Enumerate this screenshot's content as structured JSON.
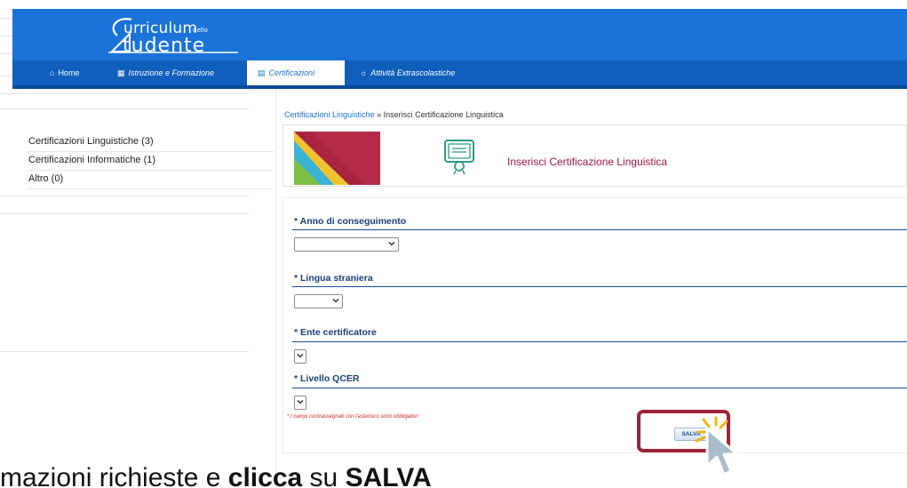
{
  "header": {
    "logo_top": "urriculum",
    "logo_small": "dello",
    "logo_bottom": "tudente"
  },
  "nav": [
    {
      "label": "Home",
      "icon": "home-icon",
      "active": false
    },
    {
      "label": "Istruzione e Formazione",
      "icon": "building-icon",
      "active": false
    },
    {
      "label": "Certificazioni",
      "icon": "certificate-icon",
      "active": true
    },
    {
      "label": "Attività Extrascolastiche",
      "icon": "sun-icon",
      "active": false
    }
  ],
  "sidebar": {
    "items": [
      {
        "label": "Certificazioni Linguistiche (3)"
      },
      {
        "label": "Certificazioni Informatiche (1)"
      },
      {
        "label": "Altro (0)"
      }
    ]
  },
  "breadcrumb": {
    "link": "Certificazioni Linguistiche",
    "separator": " » ",
    "current": "Inserisci Certificazione Linguistica"
  },
  "card": {
    "title": "Inserisci Certificazione Linguistica"
  },
  "form": {
    "fields": [
      {
        "label": "* Anno di conseguimento",
        "value": ""
      },
      {
        "label": "* Lingua straniera",
        "value": ""
      },
      {
        "label": "* Ente certificatore",
        "value": ""
      },
      {
        "label": "* Livello QCER",
        "value": ""
      }
    ],
    "required_note": "* I campi contrassegnati con l'asterisco sono obbligatori",
    "save_label": "SALVA"
  },
  "caption": {
    "prefix": "mazioni richieste e ",
    "bold1": "clicca",
    "mid": " su ",
    "bold2": "SALVA"
  },
  "colors": {
    "header_blue": "#1a73d9",
    "nav_blue": "#0f5fbd",
    "title_red": "#a1173f",
    "frame_red": "#9b2437"
  }
}
